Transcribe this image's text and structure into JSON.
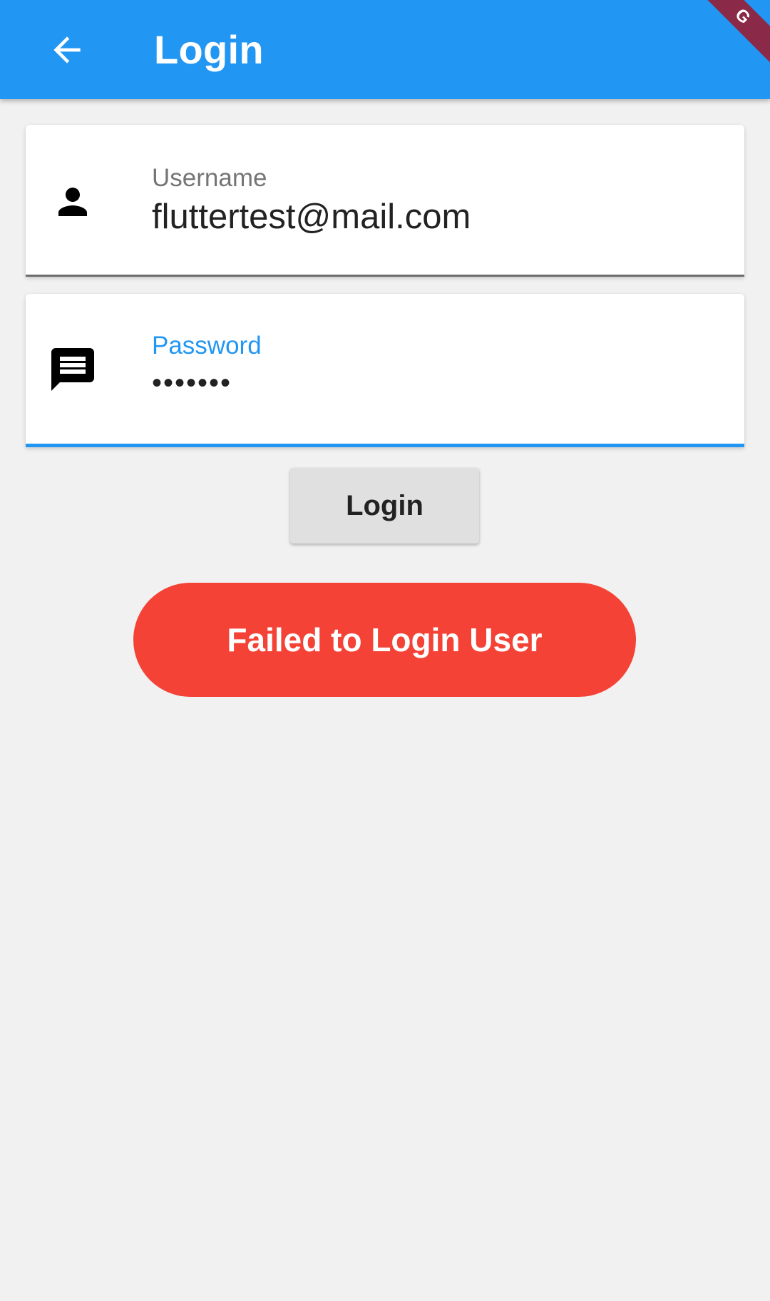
{
  "appbar": {
    "title": "Login",
    "back_icon": "arrow-back-icon",
    "background_color": "#2196f3"
  },
  "debug_banner": {
    "label": "G"
  },
  "form": {
    "username": {
      "label": "Username",
      "value": "fluttertest@mail.com",
      "icon": "person-icon"
    },
    "password": {
      "label": "Password",
      "value": "•••••••",
      "icon": "message-icon",
      "focus_color": "#2196f3"
    },
    "login_button_label": "Login"
  },
  "status": {
    "message": "Failed to Login User",
    "color": "#f44336"
  }
}
